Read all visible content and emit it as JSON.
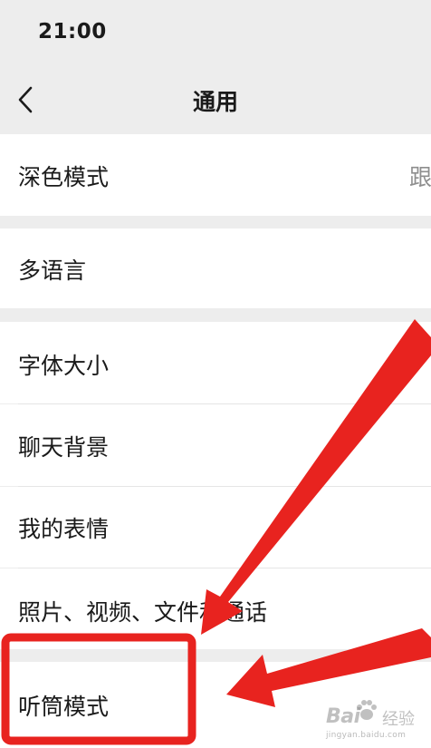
{
  "status_bar": {
    "time": "21:00"
  },
  "nav": {
    "title": "通用",
    "back_icon": "chevron-left-icon"
  },
  "settings": {
    "dark_mode": {
      "label": "深色模式",
      "value": "跟"
    },
    "language": {
      "label": "多语言"
    },
    "font_size": {
      "label": "字体大小"
    },
    "chat_background": {
      "label": "聊天背景"
    },
    "my_stickers": {
      "label": "我的表情"
    },
    "media": {
      "label": "照片、视频、文件和通话"
    },
    "earpiece_mode": {
      "label": "听筒模式"
    }
  },
  "annotations": {
    "highlight_color": "#e8231f"
  },
  "watermark": {
    "brand": "Bai",
    "brand_suffix": "经验",
    "url": "jingyan.baidu.com"
  },
  "colors": {
    "background": "#ededed",
    "row": "#ffffff",
    "text": "#1a1a1a",
    "secondary_text": "#8e8e8e"
  }
}
